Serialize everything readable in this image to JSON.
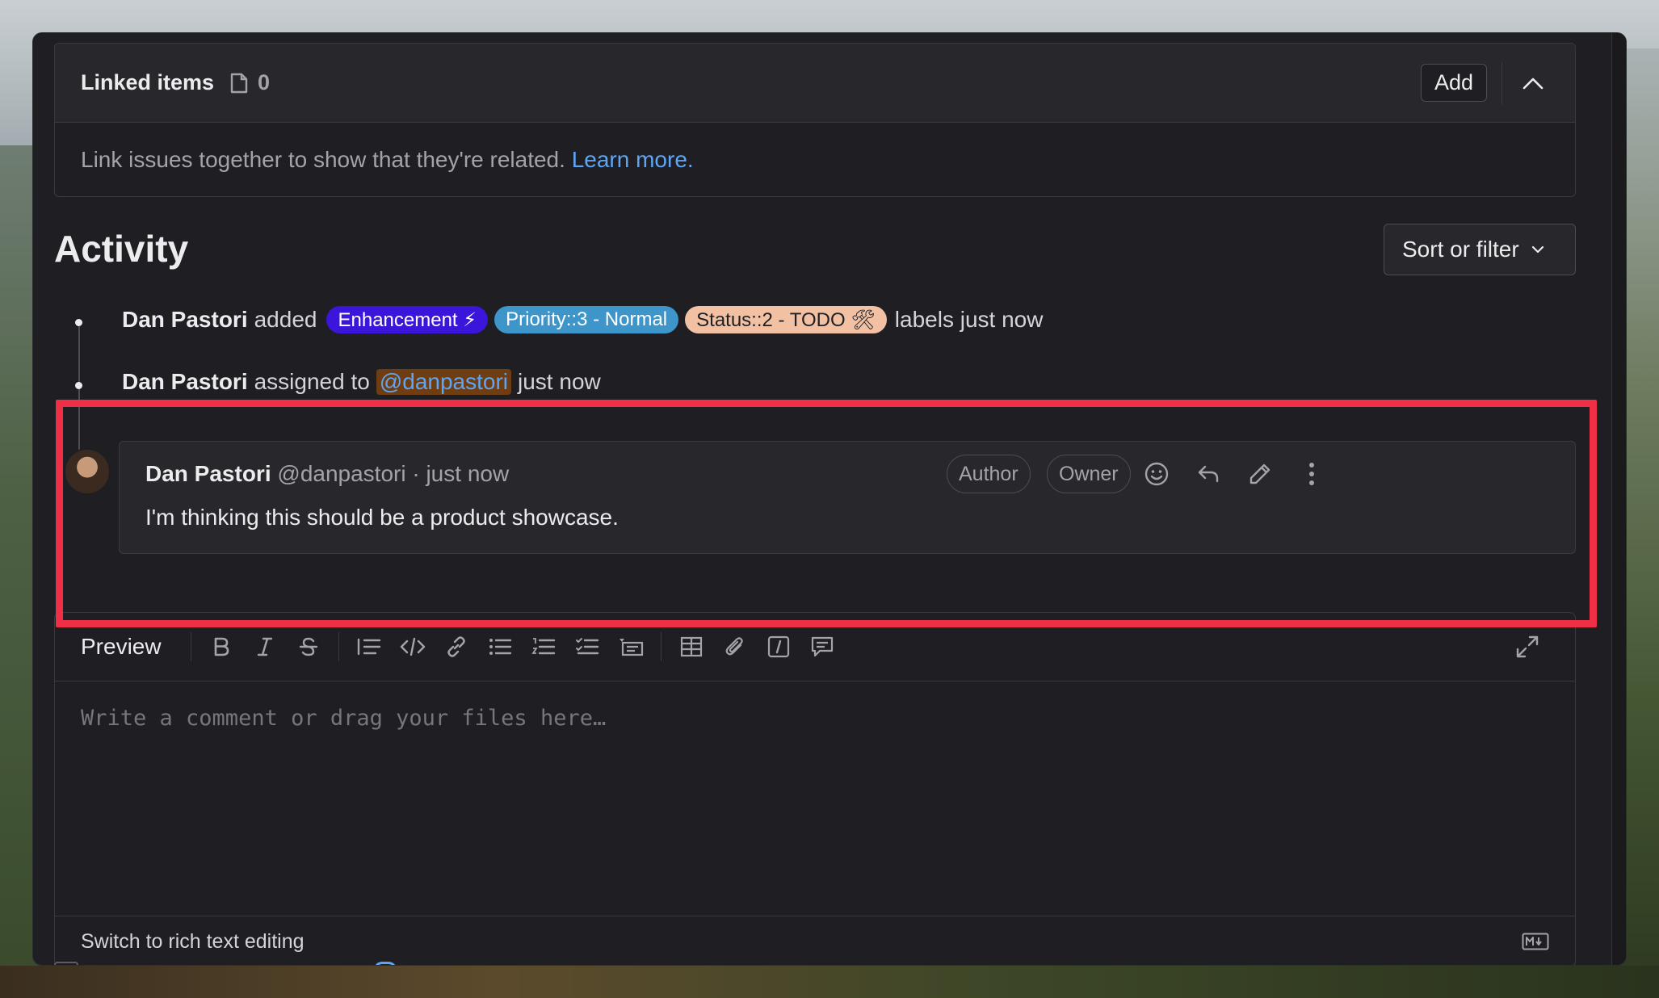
{
  "linked_items": {
    "title": "Linked items",
    "count": "0",
    "add_label": "Add",
    "body_text": "Link issues together to show that they're related.",
    "learn_more": "Learn more."
  },
  "activity": {
    "title": "Activity",
    "sort_label": "Sort or filter",
    "events": [
      {
        "user": "Dan Pastori",
        "verb": "added",
        "labels": [
          "Enhancement ⚡",
          "Priority::3 - Normal",
          "Status::2 - TODO 🛠"
        ],
        "suffix": "labels just now"
      },
      {
        "user": "Dan Pastori",
        "verb": "assigned to",
        "mention": "@danpastori",
        "suffix": "just now"
      }
    ]
  },
  "comment": {
    "author": "Dan Pastori",
    "handle": "@danpastori",
    "time": "· just now",
    "body": "I'm thinking this should be a product showcase.",
    "badges": [
      "Author",
      "Owner"
    ]
  },
  "editor": {
    "tab": "Preview",
    "placeholder": "Write a comment or drag your files here…",
    "switch_label": "Switch to rich text editing",
    "toolbar_icons": [
      "bold-icon",
      "italic-icon",
      "strikethrough-icon",
      "quote-icon",
      "code-icon",
      "link-icon",
      "bullet-list-icon",
      "numbered-list-icon",
      "task-list-icon",
      "collapsible-icon",
      "table-icon",
      "attach-icon",
      "slash-command-icon",
      "comment-template-icon",
      "fullscreen-icon"
    ]
  },
  "colors": {
    "highlight": "#ef2f46",
    "link": "#5ea6f5",
    "label_enhancement": "#3b15d9",
    "label_priority": "#3e95c9",
    "label_status": "#f2c1a4"
  }
}
